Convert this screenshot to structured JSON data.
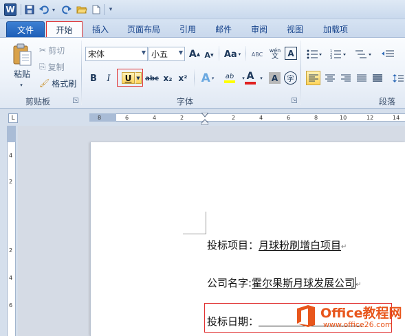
{
  "quick_access": {
    "app_icon": "W",
    "icons": [
      "word-logo-icon",
      "save-icon",
      "undo-icon",
      "redo-icon",
      "open-folder-icon",
      "new-document-icon",
      "customize-qat-icon"
    ]
  },
  "tabs": [
    "文件",
    "开始",
    "插入",
    "页面布局",
    "引用",
    "邮件",
    "审阅",
    "视图",
    "加载项"
  ],
  "clipboard": {
    "paste_label": "粘贴",
    "cut_label": "剪切",
    "copy_label": "复制",
    "format_painter_label": "格式刷",
    "group_label": "剪贴板"
  },
  "font": {
    "font_name": "宋体",
    "font_size": "小五",
    "grow_label": "A",
    "shrink_label": "A",
    "change_case_label": "Aa",
    "clear_format_label": "ABC",
    "phonetic_label": "wén",
    "border_char_label": "A",
    "bold_label": "B",
    "italic_label": "I",
    "underline_label": "U",
    "strikethrough_label": "abc",
    "subscript_label": "x₂",
    "superscript_label": "x²",
    "text_effect_label": "A",
    "highlight_label": "ab",
    "font_color_label": "A",
    "char_shading_label": "A",
    "enclose_char_label": "字",
    "group_label": "字体"
  },
  "paragraph": {
    "group_label": "段落"
  },
  "ruler": {
    "ticks": [
      "8",
      "6",
      "4",
      "2",
      "2",
      "4",
      "6",
      "8",
      "10",
      "12",
      "14"
    ],
    "corner_label": "L",
    "vticks": [
      "4",
      "2",
      "2",
      "4",
      "6"
    ]
  },
  "document": {
    "line1_label": "投标项目：",
    "line1_value": "月球粉刷增白项目",
    "line2_label": "公司名字:",
    "line2_value": "霍尔果斯月球发展公司",
    "line3_label": "投标日期："
  },
  "watermark": {
    "title": "Office教程网",
    "url": "www.office26.com"
  },
  "colors": {
    "highlight_red": "#e03030",
    "file_tab_blue": "#1f5fb7",
    "watermark_orange": "#e8561c"
  }
}
